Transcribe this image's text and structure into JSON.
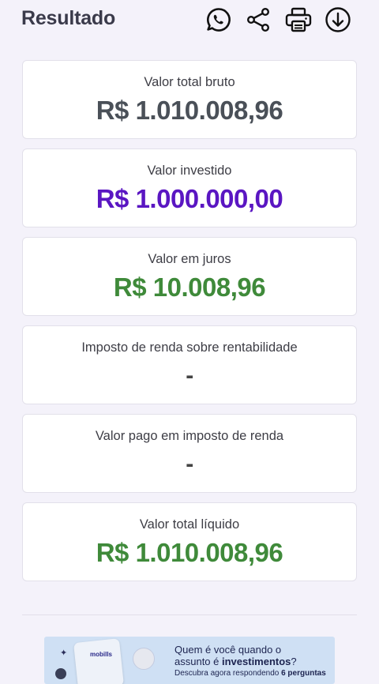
{
  "header": {
    "title": "Resultado",
    "actions": [
      {
        "icon": "whatsapp-icon"
      },
      {
        "icon": "share-icon"
      },
      {
        "icon": "printer-icon"
      },
      {
        "icon": "download-icon"
      }
    ]
  },
  "cards": [
    {
      "label": "Valor total bruto",
      "value": "R$ 1.010.008,96",
      "color": "#4a5058"
    },
    {
      "label": "Valor investido",
      "value": "R$ 1.000.000,00",
      "color": "#5a16c2"
    },
    {
      "label": "Valor em juros",
      "value": "R$ 10.008,96",
      "color": "#3f8a3a"
    },
    {
      "label": "Imposto de renda sobre rentabilidade",
      "value": "-",
      "color": "#444444"
    },
    {
      "label": "Valor pago em imposto de renda",
      "value": "-",
      "color": "#444444"
    },
    {
      "label": "Valor total líquido",
      "value": "R$ 1.010.008,96",
      "color": "#3f8a3a"
    }
  ],
  "banner": {
    "brand": "mobills",
    "line1": "Quem é você quando o",
    "line2_prefix": "assunto é ",
    "line2_bold": "investimentos",
    "line2_suffix": "?",
    "line3_prefix": "Descubra agora respondendo ",
    "line3_bold": "6 perguntas"
  },
  "colors": {
    "background": "#f4f2fa",
    "title": "#3a3a4a",
    "purple": "#5a16c2",
    "green": "#3f8a3a",
    "gray": "#4a5058"
  }
}
